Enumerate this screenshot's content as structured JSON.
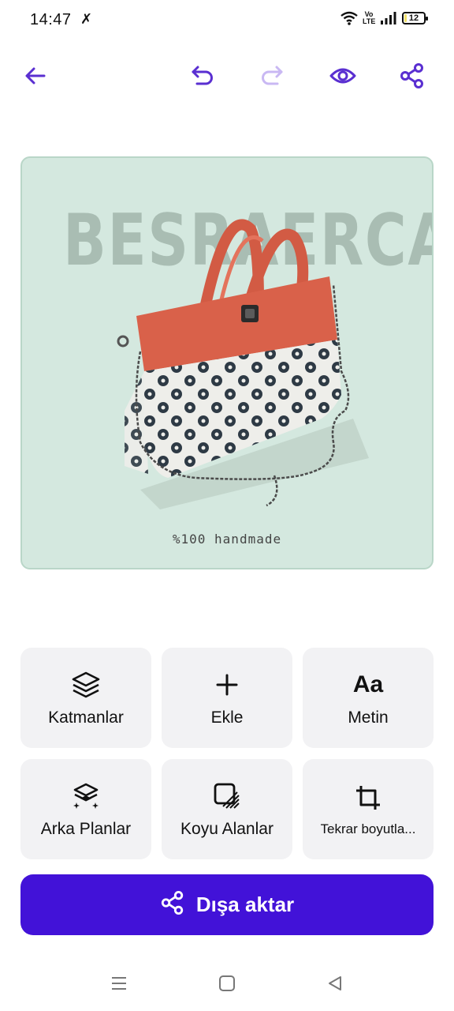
{
  "status": {
    "time": "14:47",
    "volte": "Vo LTE",
    "battery": "12",
    "battery_level": 0.12
  },
  "toolbar": {
    "icons": [
      "back-arrow-icon",
      "undo-icon",
      "redo-icon",
      "preview-eye-icon",
      "share-icon"
    ]
  },
  "canvas": {
    "brand": "BESRAERCAN",
    "caption": "%100 handmade",
    "background": "#d4e8df"
  },
  "tools": [
    {
      "label": "Katmanlar",
      "icon": "layers-icon"
    },
    {
      "label": "Ekle",
      "icon": "plus-icon"
    },
    {
      "label": "Metin",
      "icon": "text-icon",
      "glyph": "Aa"
    },
    {
      "label": "Arka Planlar",
      "icon": "backgrounds-icon"
    },
    {
      "label": "Koyu Alanlar",
      "icon": "dark-areas-icon"
    },
    {
      "label": "Tekrar boyutla...",
      "icon": "crop-resize-icon"
    }
  ],
  "export": {
    "label": "Dışa aktar",
    "icon": "share-icon"
  },
  "colors": {
    "accent": "#4212d8",
    "icon_accent": "#5a2fd1",
    "icon_disabled": "#c9b8f3"
  }
}
